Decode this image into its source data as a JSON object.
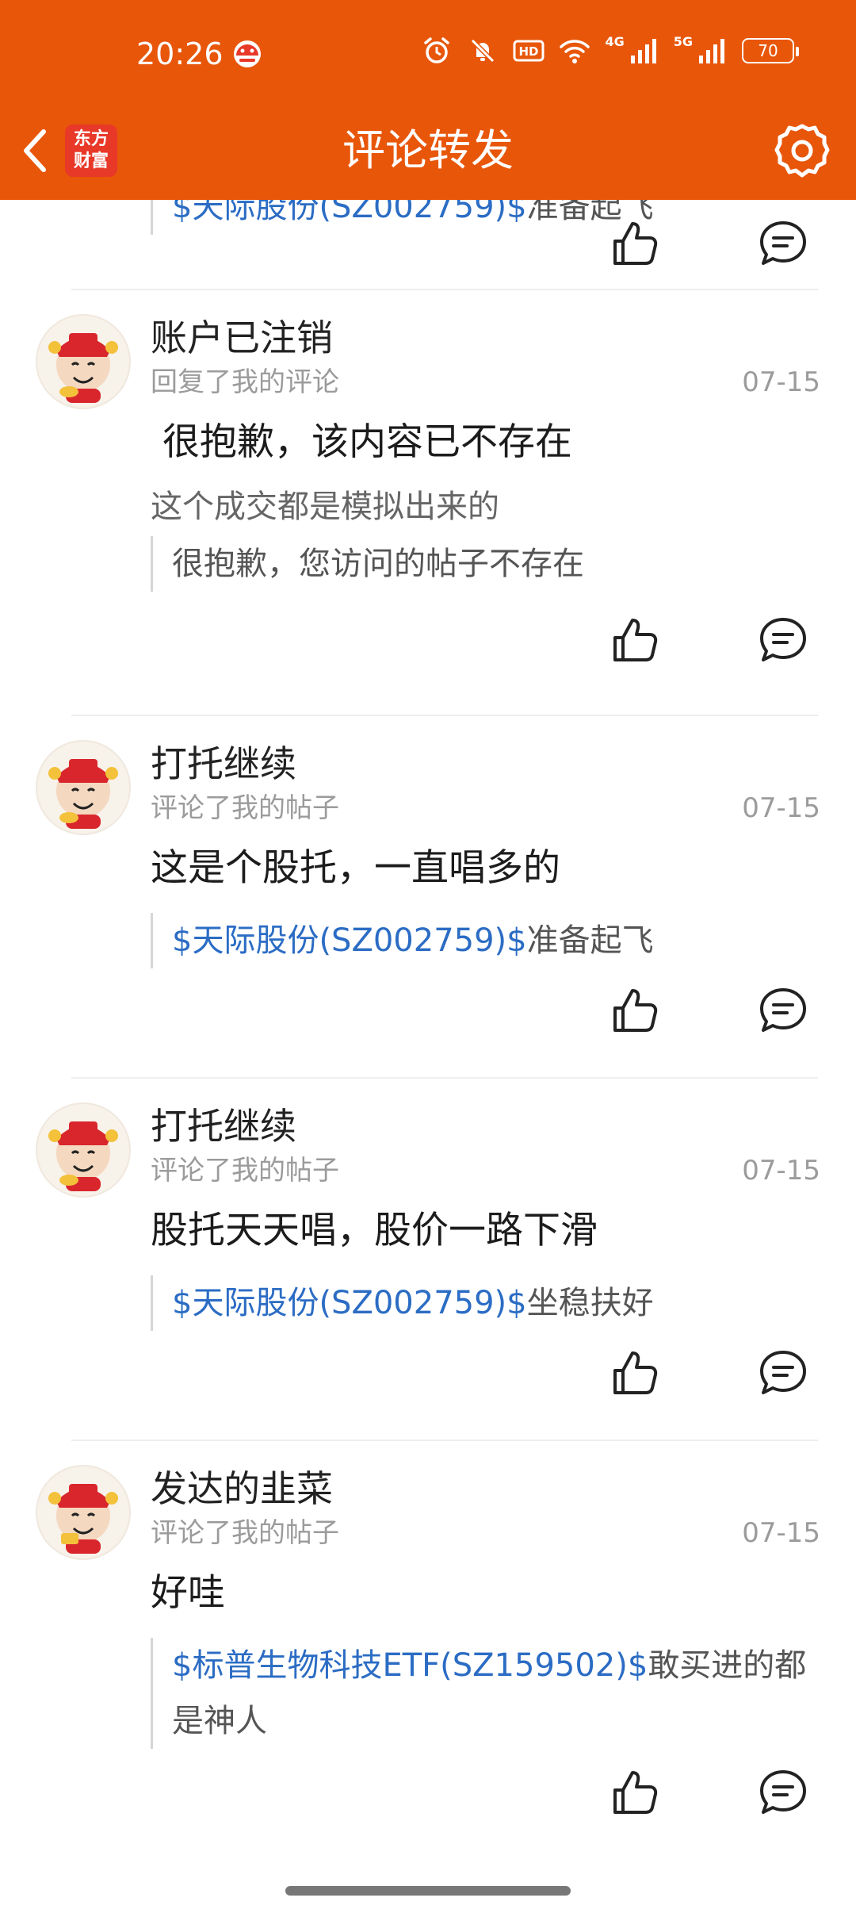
{
  "status_bar": {
    "time": "20:26",
    "network_1": "4G",
    "network_2": "5G",
    "battery": "70"
  },
  "header": {
    "logo_line1": "东方",
    "logo_line2": "财富",
    "title": "评论转发",
    "bg_color": "#E8560A"
  },
  "partial_item": {
    "quote_stock": "$天际股份(SZ002759)$",
    "quote_text": "准备起飞"
  },
  "items": [
    {
      "username": "账户已注销",
      "action": "回复了我的评论",
      "date": "07-15",
      "content": " 很抱歉，该内容已不存在",
      "sub": "这个成交都是模拟出来的",
      "quote_stock": "",
      "quote_text": "很抱歉，您访问的帖子不存在"
    },
    {
      "username": "打托继续",
      "action": "评论了我的帖子",
      "date": "07-15",
      "content": "这是个股托，一直唱多的",
      "quote_stock": "$天际股份(SZ002759)$",
      "quote_text": "准备起飞"
    },
    {
      "username": "打托继续",
      "action": "评论了我的帖子",
      "date": "07-15",
      "content": "股托天天唱，股价一路下滑",
      "quote_stock": "$天际股份(SZ002759)$",
      "quote_text": "坐稳扶好"
    },
    {
      "username": "发达的韭菜",
      "action": "评论了我的帖子",
      "date": "07-15",
      "content": "好哇",
      "quote_stock": "$标普生物科技ETF(SZ159502)$",
      "quote_text": "敢买进的都是神人"
    }
  ],
  "colors": {
    "link": "#2B6CC4",
    "muted": "#9b9b9b"
  }
}
